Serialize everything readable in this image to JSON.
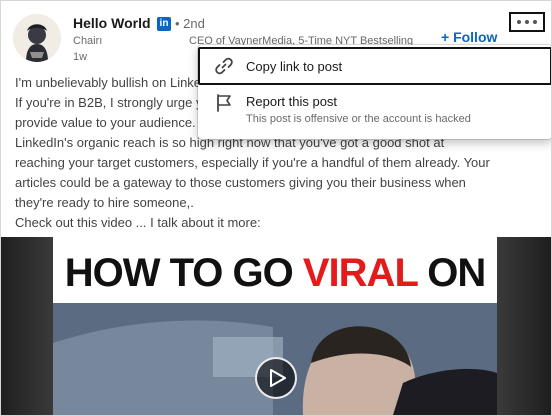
{
  "author": {
    "name": "Hello World",
    "badge": "in",
    "degree": "• 2nd",
    "headline": "Chairı",
    "headline_overflow": "CEO of VaynerMedia, 5-Time NYT Bestselling",
    "time_ago": "1w"
  },
  "follow_label": "+ Follow",
  "more_icon": "more-horizontal-icon",
  "post_lines": [
    "I'm unbelievably bullish on LinkedIn right now.",
    "If you're in B2B, I strongly urge you to start producing content that will",
    "provide value to your audience.",
    "LinkedIn's organic reach is so high right now that you've got a good shot at",
    "reaching your target customers, especially if you're a handful of them already. Your",
    "articles could be a gateway to those customers giving you their business when",
    "they're ready to hire someone,.",
    "Check out this video ... I talk about it more:"
  ],
  "video": {
    "title_before": "HOW TO GO ",
    "title_highlight": "VIRAL",
    "title_after": " ON",
    "highlight_color": "#e21b1b"
  },
  "menu": {
    "copy_label": "Copy link to post",
    "copy_icon": "link-icon",
    "report_label": "Report this post",
    "report_sub": "This post is offensive or the account is hacked",
    "report_icon": "flag-icon"
  },
  "colors": {
    "brand": "#0a66c2"
  }
}
